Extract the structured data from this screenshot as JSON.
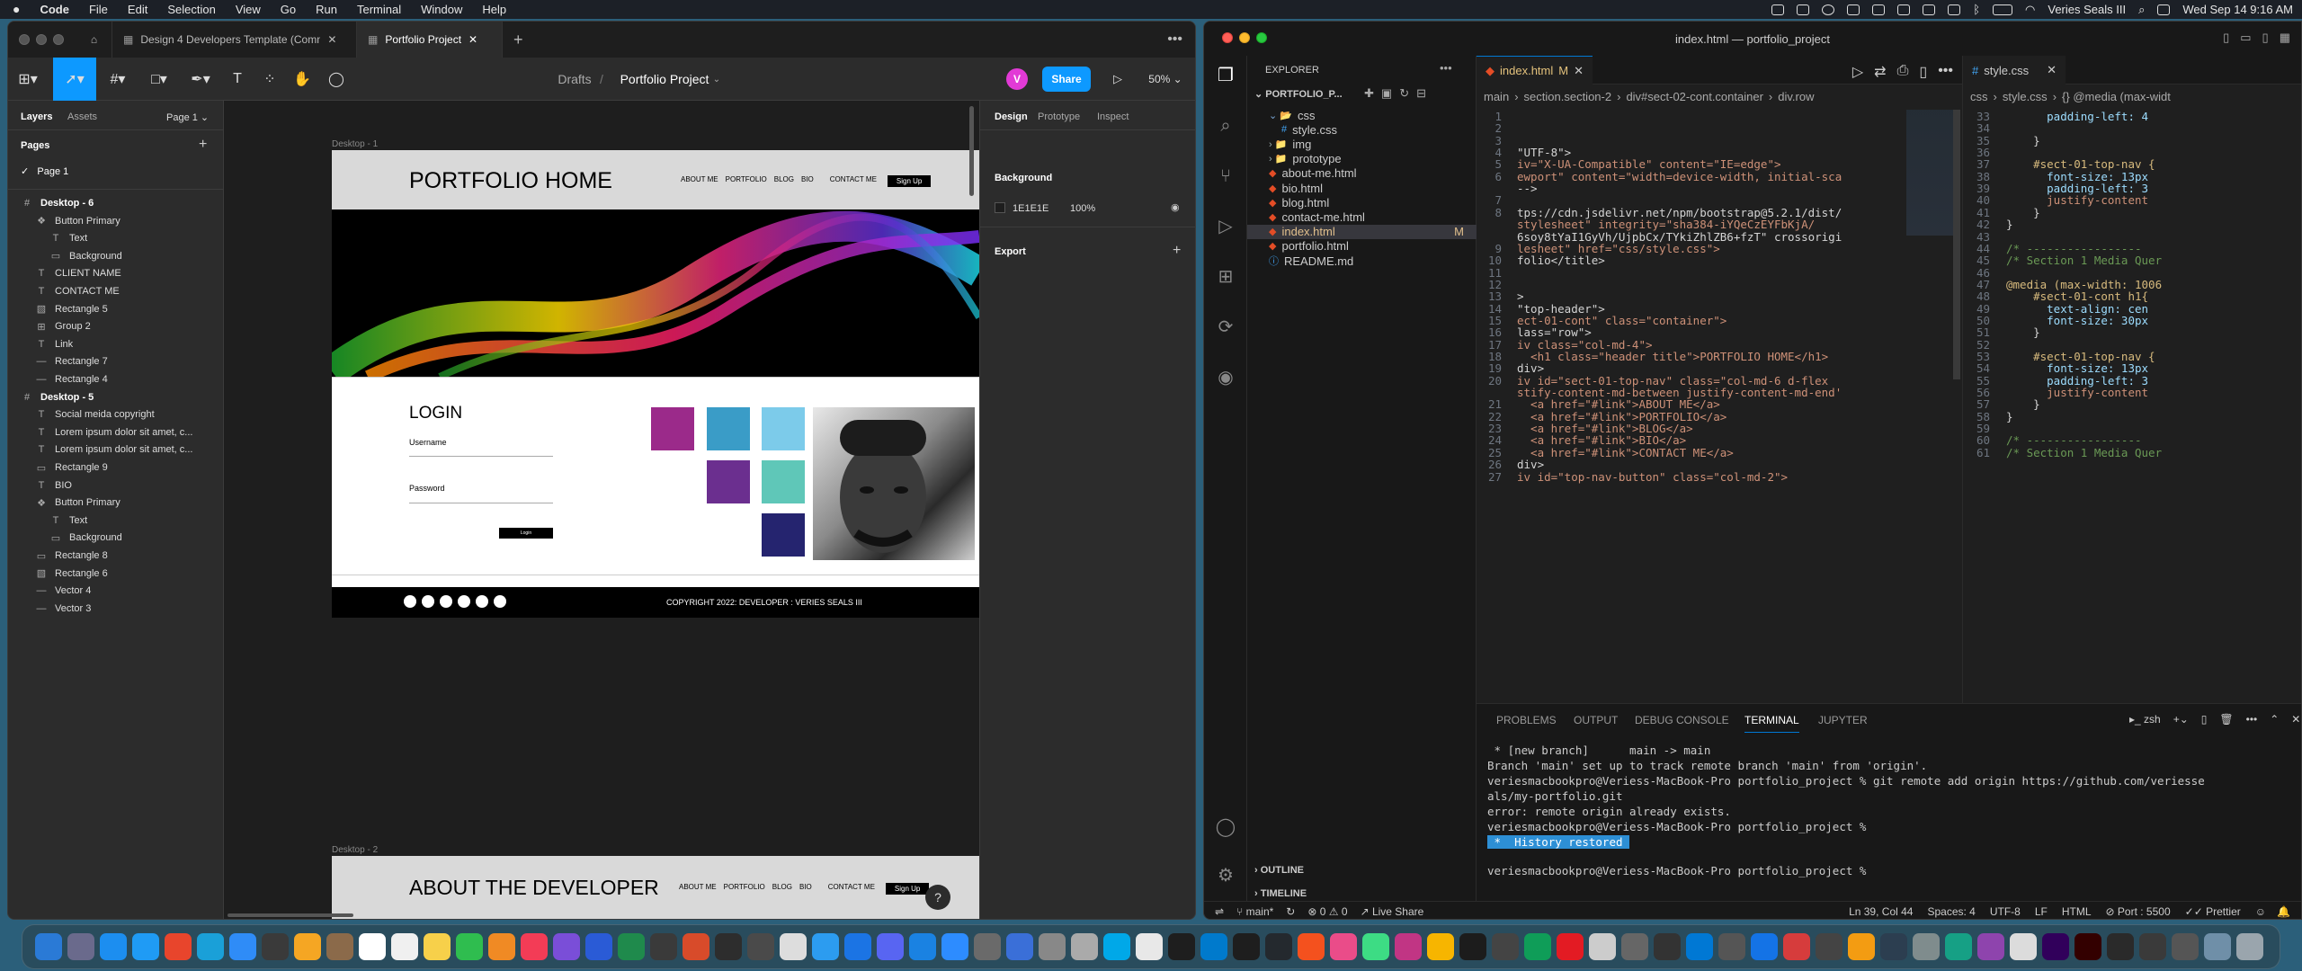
{
  "menubar": {
    "apple": "",
    "app": "Code",
    "items": [
      "File",
      "Edit",
      "Selection",
      "View",
      "Go",
      "Run",
      "Terminal",
      "Window",
      "Help"
    ],
    "user": "Veries Seals III",
    "datetime": "Wed Sep 14  9:16 AM"
  },
  "figma": {
    "tabs": [
      "Design 4 Developers Template (Communit",
      "Portfolio Project"
    ],
    "breadcrumb": {
      "drafts": "Drafts",
      "sep": "/",
      "project": "Portfolio Project"
    },
    "avatar": "V",
    "share": "Share",
    "zoom": "50%",
    "layers_tabs": {
      "layers": "Layers",
      "assets": "Assets",
      "page": "Page 1"
    },
    "pages_title": "Pages",
    "page1": "Page 1",
    "layer_rows": [
      {
        "t": "Desktop - 6",
        "kind": "frame",
        "indent": 0
      },
      {
        "t": "Button Primary",
        "kind": "component",
        "indent": 1
      },
      {
        "t": "Text",
        "kind": "text",
        "indent": 2
      },
      {
        "t": "Background",
        "kind": "rect",
        "indent": 2
      },
      {
        "t": "CLIENT NAME",
        "kind": "text",
        "indent": 1
      },
      {
        "t": "CONTACT ME",
        "kind": "text",
        "indent": 1
      },
      {
        "t": "Rectangle 5",
        "kind": "image",
        "indent": 1
      },
      {
        "t": "Group 2",
        "kind": "group",
        "indent": 1
      },
      {
        "t": "Link",
        "kind": "text",
        "indent": 1
      },
      {
        "t": "Rectangle 7",
        "kind": "line",
        "indent": 1
      },
      {
        "t": "Rectangle 4",
        "kind": "line",
        "indent": 1
      },
      {
        "t": "Desktop - 5",
        "kind": "frame",
        "indent": 0
      },
      {
        "t": "Social meida copyright",
        "kind": "text",
        "indent": 1
      },
      {
        "t": "Lorem ipsum dolor sit amet, c...",
        "kind": "text",
        "indent": 1
      },
      {
        "t": "Lorem ipsum dolor sit amet, c...",
        "kind": "text",
        "indent": 1
      },
      {
        "t": "Rectangle 9",
        "kind": "rect",
        "indent": 1
      },
      {
        "t": "BIO",
        "kind": "text",
        "indent": 1
      },
      {
        "t": "Button Primary",
        "kind": "component",
        "indent": 1
      },
      {
        "t": "Text",
        "kind": "text",
        "indent": 2
      },
      {
        "t": "Background",
        "kind": "rect",
        "indent": 2
      },
      {
        "t": "Rectangle 8",
        "kind": "rect",
        "indent": 1
      },
      {
        "t": "Rectangle 6",
        "kind": "image",
        "indent": 1
      },
      {
        "t": "Vector 4",
        "kind": "line",
        "indent": 1
      },
      {
        "t": "Vector 3",
        "kind": "line",
        "indent": 1
      }
    ],
    "frame1": {
      "label": "Desktop - 1",
      "title": "PORTFOLIO HOME",
      "nav": [
        "ABOUT ME",
        "PORTFOLIO",
        "BLOG",
        "BIO"
      ],
      "contact": "CONTACT ME",
      "signup": "Sign Up",
      "login": "LOGIN",
      "username": "Username",
      "password": "Password",
      "btn": "Login",
      "copyright": "COPYRIGHT 2022: DEVELOPER : VERIES SEALS III"
    },
    "frame2": {
      "label": "Desktop - 2",
      "title": "ABOUT THE DEVELOPER",
      "nav": [
        "ABOUT ME",
        "PORTFOLIO",
        "BLOG",
        "BIO"
      ],
      "contact": "CONTACT ME",
      "signup": "Sign Up"
    },
    "props": {
      "tabs": [
        "Design",
        "Prototype",
        "Inspect"
      ],
      "background": "Background",
      "hex": "1E1E1E",
      "opacity": "100%",
      "export": "Export"
    },
    "help": "?",
    "colors": {
      "accent": "#0d99ff",
      "squares": [
        "#9b2a8a",
        "#3a9cc7",
        "#7ccbea",
        "#6b2f8f",
        "#5fc7b8",
        "#25246f"
      ]
    }
  },
  "vscode": {
    "title": "index.html — portfolio_project",
    "explorer": {
      "title": "EXPLORER",
      "project": "PORTFOLIO_P...",
      "items": [
        {
          "t": "css",
          "k": "folder-open",
          "i": 1
        },
        {
          "t": "style.css",
          "k": "css",
          "i": 2
        },
        {
          "t": "img",
          "k": "folder",
          "i": 1
        },
        {
          "t": "prototype",
          "k": "folder",
          "i": 1
        },
        {
          "t": "about-me.html",
          "k": "html",
          "i": 1
        },
        {
          "t": "bio.html",
          "k": "html",
          "i": 1
        },
        {
          "t": "blog.html",
          "k": "html",
          "i": 1
        },
        {
          "t": "contact-me.html",
          "k": "html",
          "i": 1
        },
        {
          "t": "index.html",
          "k": "html",
          "i": 1,
          "badge": "M"
        },
        {
          "t": "portfolio.html",
          "k": "html",
          "i": 1
        },
        {
          "t": "README.md",
          "k": "info",
          "i": 1
        }
      ],
      "outline": "OUTLINE",
      "timeline": "TIMELINE"
    },
    "tab1": {
      "name": "index.html",
      "badge": "M"
    },
    "crumbs1": [
      "main",
      "section.section-2",
      "div#sect-02-cont.container",
      "div.row"
    ],
    "code1": [
      {
        "n": "1",
        "t": ""
      },
      {
        "n": "2",
        "t": ""
      },
      {
        "n": "3",
        "t": ""
      },
      {
        "n": "4",
        "t": "\"UTF-8\">"
      },
      {
        "n": "5",
        "t": "iv=\"X-UA-Compatible\" content=\"IE=edge\">"
      },
      {
        "n": "6",
        "t": "ewport\" content=\"width=device-width, initial-sca"
      },
      {
        "n": "",
        "t": "-->"
      },
      {
        "n": "7",
        "t": ""
      },
      {
        "n": "8",
        "t": "tps://cdn.jsdelivr.net/npm/bootstrap@5.2.1/dist/"
      },
      {
        "n": "",
        "t": "stylesheet\" integrity=\"sha384-iYQeCzEYFbKjA/"
      },
      {
        "n": "",
        "t": "6soy8tYaI1GyVh/UjpbCx/TYkiZhlZB6+fzT\" crossorigi"
      },
      {
        "n": "9",
        "t": "lesheet\" href=\"css/style.css\">"
      },
      {
        "n": "10",
        "t": "folio</title>"
      },
      {
        "n": "11",
        "t": ""
      },
      {
        "n": "12",
        "t": ""
      },
      {
        "n": "13",
        "t": ">"
      },
      {
        "n": "14",
        "t": "\"top-header\">"
      },
      {
        "n": "15",
        "t": "ect-01-cont\" class=\"container\">"
      },
      {
        "n": "16",
        "t": "lass=\"row\">"
      },
      {
        "n": "17",
        "t": "iv class=\"col-md-4\">"
      },
      {
        "n": "18",
        "t": "  <h1 class=\"header title\">PORTFOLIO HOME</h1>"
      },
      {
        "n": "19",
        "t": "div>"
      },
      {
        "n": "20",
        "t": "iv id=\"sect-01-top-nav\" class=\"col-md-6 d-flex"
      },
      {
        "n": "",
        "t": "stify-content-md-between justify-content-md-end'"
      },
      {
        "n": "21",
        "t": "  <a href=\"#link\">ABOUT ME</a>"
      },
      {
        "n": "22",
        "t": "  <a href=\"#link\">PORTFOLIO</a>"
      },
      {
        "n": "23",
        "t": "  <a href=\"#link\">BLOG</a>"
      },
      {
        "n": "24",
        "t": "  <a href=\"#link\">BIO</a>"
      },
      {
        "n": "25",
        "t": "  <a href=\"#link\">CONTACT ME</a>"
      },
      {
        "n": "26",
        "t": "div>"
      },
      {
        "n": "27",
        "t": "iv id=\"top-nav-button\" class=\"col-md-2\">"
      }
    ],
    "tab2": {
      "name": "style.css"
    },
    "crumbs2": [
      "css",
      "style.css",
      "{} @media (max-widt"
    ],
    "code2": [
      {
        "n": "33",
        "t": "      padding-left: 4"
      },
      {
        "n": "34",
        "t": ""
      },
      {
        "n": "35",
        "t": "    }"
      },
      {
        "n": "36",
        "t": ""
      },
      {
        "n": "37",
        "t": "    #sect-01-top-nav {"
      },
      {
        "n": "38",
        "t": "      font-size: 13px"
      },
      {
        "n": "39",
        "t": "      padding-left: 3"
      },
      {
        "n": "40",
        "t": "      justify-content"
      },
      {
        "n": "41",
        "t": "    }"
      },
      {
        "n": "42",
        "t": "}"
      },
      {
        "n": "43",
        "t": ""
      },
      {
        "n": "44",
        "t": "/* -----------------"
      },
      {
        "n": "45",
        "t": "/* Section 1 Media Quer"
      },
      {
        "n": "46",
        "t": ""
      },
      {
        "n": "47",
        "t": "@media (max-width: 1006"
      },
      {
        "n": "48",
        "t": "    #sect-01-cont h1{"
      },
      {
        "n": "49",
        "t": "      text-align: cen"
      },
      {
        "n": "50",
        "t": "      font-size: 30px"
      },
      {
        "n": "51",
        "t": "    }"
      },
      {
        "n": "52",
        "t": ""
      },
      {
        "n": "53",
        "t": "    #sect-01-top-nav {"
      },
      {
        "n": "54",
        "t": "      font-size: 13px"
      },
      {
        "n": "55",
        "t": "      padding-left: 3"
      },
      {
        "n": "56",
        "t": "      justify-content"
      },
      {
        "n": "57",
        "t": "    }"
      },
      {
        "n": "58",
        "t": "}"
      },
      {
        "n": "59",
        "t": ""
      },
      {
        "n": "60",
        "t": "/* -----------------"
      },
      {
        "n": "61",
        "t": "/* Section 1 Media Quer"
      }
    ],
    "panel_tabs": [
      "PROBLEMS",
      "OUTPUT",
      "DEBUG CONSOLE",
      "TERMINAL",
      "JUPYTER"
    ],
    "shell": "zsh",
    "terminal": [
      " * [new branch]      main -> main",
      "Branch 'main' set up to track remote branch 'main' from 'origin'.",
      "veriesmacbookpro@Veriess-MacBook-Pro portfolio_project % git remote add origin https://github.com/veriesse",
      "als/my-portfolio.git",
      "error: remote origin already exists.",
      "veriesmacbookpro@Veriess-MacBook-Pro portfolio_project %"
    ],
    "history": " *  History restored ",
    "prompt": "veriesmacbookpro@Veriess-MacBook-Pro portfolio_project % ",
    "status": {
      "branch": "main*",
      "errors": "0",
      "warnings": "0",
      "live_share": "Live Share",
      "pos": "Ln 39, Col 44",
      "spaces": "Spaces: 4",
      "enc": "UTF-8",
      "eol": "LF",
      "lang": "HTML",
      "port": "Port : 5500",
      "prettier": "Prettier"
    }
  }
}
